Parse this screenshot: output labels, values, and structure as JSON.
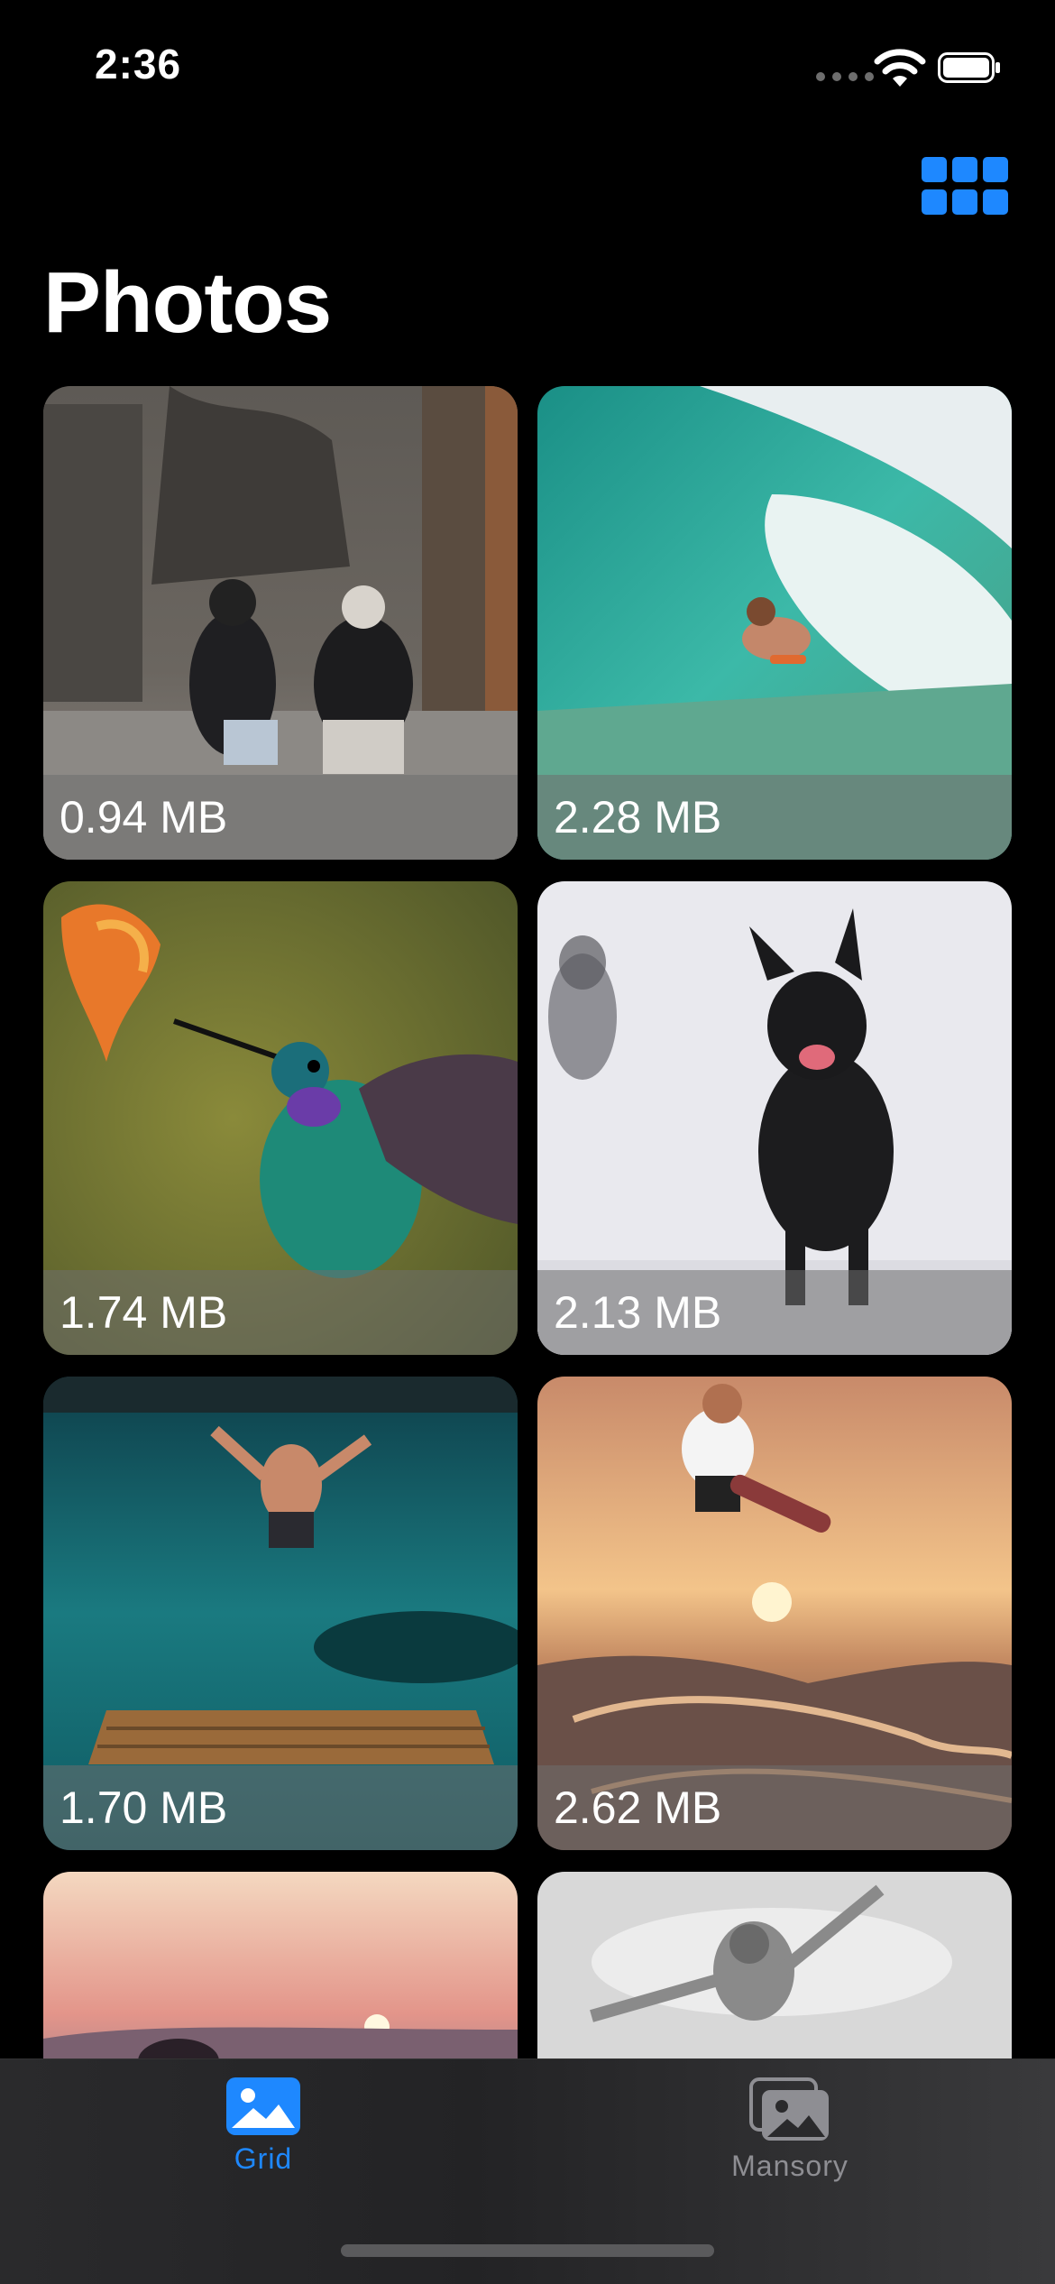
{
  "status_bar": {
    "time": "2:36",
    "icons": [
      "signal-dots-icon",
      "wifi-icon",
      "battery-icon"
    ]
  },
  "nav": {
    "title": "Photos",
    "layout_toggle_icon": "grid-3x2-icon"
  },
  "colors": {
    "accent": "#1e88ff",
    "background": "#000000",
    "inactive_tab": "#8e8e93"
  },
  "photos": [
    {
      "size": "0.94 MB",
      "subject": "street-scene"
    },
    {
      "size": "2.28 MB",
      "subject": "surfer-wave"
    },
    {
      "size": "1.74 MB",
      "subject": "hummingbird"
    },
    {
      "size": "2.13 MB",
      "subject": "dogs-snow"
    },
    {
      "size": "1.70 MB",
      "subject": "cliff-jump"
    },
    {
      "size": "2.62 MB",
      "subject": "skateboarder"
    },
    {
      "size": "",
      "subject": "sunset"
    },
    {
      "size": "",
      "subject": "jumping-man"
    }
  ],
  "tabs": [
    {
      "label": "Grid",
      "icon": "photo-icon",
      "active": true
    },
    {
      "label": "Mansory",
      "icon": "photo-stack-icon",
      "active": false
    }
  ]
}
